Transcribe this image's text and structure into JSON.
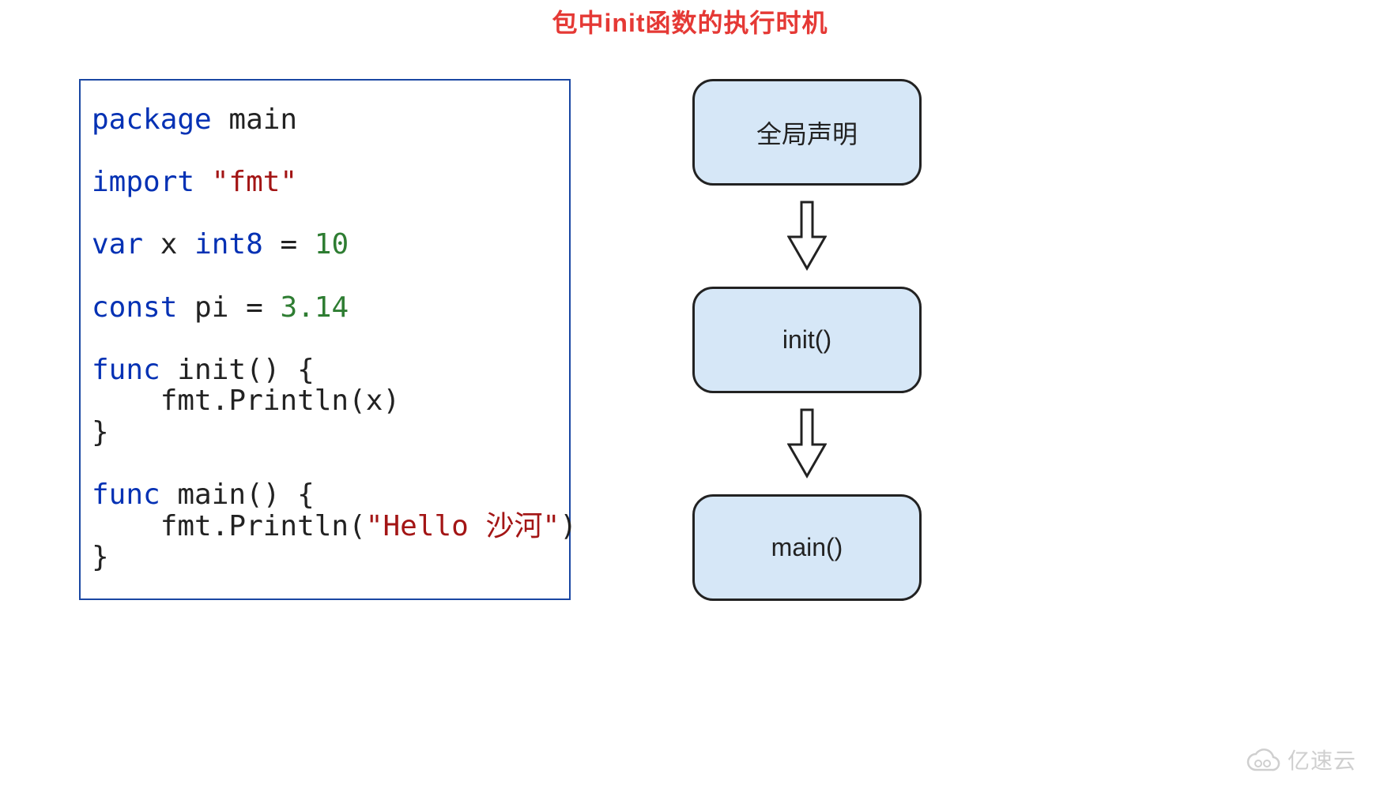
{
  "title": "包中init函数的执行时机",
  "code": {
    "line1_kw": "package",
    "line1_rest": " main",
    "line2_kw": "import",
    "line2_str": " \"fmt\"",
    "line3_kw": "var",
    "line3_name": " x ",
    "line3_type": "int8",
    "line3_eq": " = ",
    "line3_num": "10",
    "line4_kw": "const",
    "line4_name": " pi ",
    "line4_eq": "= ",
    "line4_num": "3.14",
    "line5_kw": "func",
    "line5_sig": " init() {",
    "line6": "    fmt.Println(x)",
    "line7": "}",
    "line8_kw": "func",
    "line8_sig": " main() {",
    "line9a": "    fmt.Println(",
    "line9b": "\"Hello 沙河\"",
    "line9c": ")",
    "line10": "}"
  },
  "flow": {
    "step1": "全局声明",
    "step2": "init()",
    "step3": "main()"
  },
  "watermark": "亿速云",
  "colors": {
    "title": "#e53935",
    "box_fill": "#d6e7f7",
    "box_border": "#222222",
    "code_border": "#1a47a3",
    "keyword": "#0431b4",
    "string": "#a31515",
    "number": "#2e7d32"
  }
}
